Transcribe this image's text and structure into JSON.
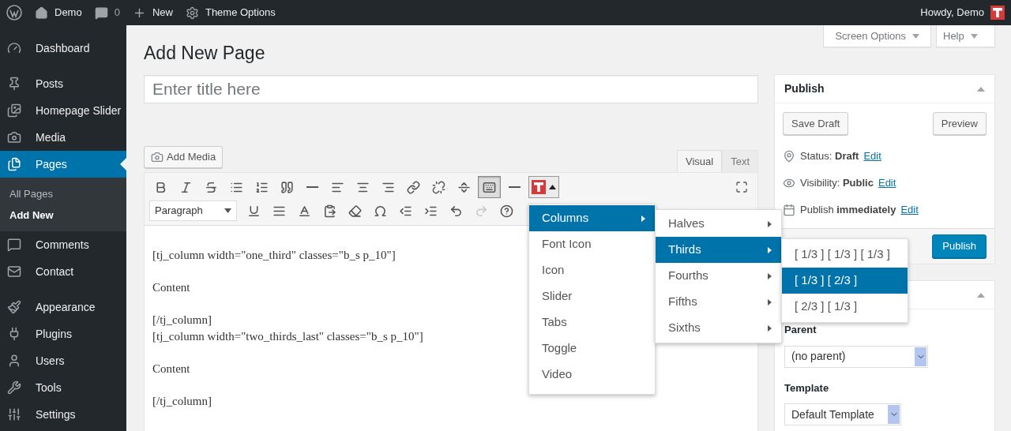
{
  "top_bar": {
    "items": [
      {
        "kind": "home",
        "label": "Demo"
      },
      {
        "kind": "comments",
        "label": "0"
      },
      {
        "kind": "new",
        "label": "New"
      },
      {
        "kind": "gear",
        "label": "Theme Options"
      }
    ],
    "greeting": "Howdy, Demo"
  },
  "sidebar": {
    "groups": [
      [
        {
          "kind": "dashboard",
          "label": "Dashboard",
          "selected": false
        }
      ],
      [
        {
          "kind": "posts",
          "label": "Posts",
          "selected": false
        },
        {
          "kind": "slider",
          "label": "Homepage Slider",
          "selected": false
        },
        {
          "kind": "media",
          "label": "Media",
          "selected": false
        },
        {
          "kind": "pages",
          "label": "Pages",
          "selected": true,
          "children": [
            {
              "label": "All Pages",
              "selected": false
            },
            {
              "label": "Add New",
              "selected": true
            }
          ]
        },
        {
          "kind": "comments",
          "label": "Comments",
          "selected": false
        },
        {
          "kind": "contact",
          "label": "Contact",
          "selected": false
        }
      ],
      [
        {
          "kind": "appearance",
          "label": "Appearance",
          "selected": false
        },
        {
          "kind": "plugins",
          "label": "Plugins",
          "selected": false
        },
        {
          "kind": "users",
          "label": "Users",
          "selected": false
        },
        {
          "kind": "tools",
          "label": "Tools",
          "selected": false
        },
        {
          "kind": "settings",
          "label": "Settings",
          "selected": false
        }
      ]
    ]
  },
  "screen_tabs": [
    "Screen Options",
    "Help"
  ],
  "page_title": "Add New Page",
  "title_field": {
    "placeholder": "Enter title here"
  },
  "add_media": "Add Media",
  "editor_tabs": [
    {
      "label": "Visual",
      "selected": true
    },
    {
      "label": "Text",
      "selected": false
    }
  ],
  "toolbar": {
    "rows": [
      {
        "tools": [
          {
            "kind": "bold",
            "pressed": false,
            "disabled": false
          },
          {
            "kind": "italic",
            "pressed": false,
            "disabled": false
          },
          {
            "kind": "strike",
            "pressed": false,
            "disabled": false
          },
          {
            "kind": "bullets",
            "pressed": false,
            "disabled": false
          },
          {
            "kind": "numbers",
            "pressed": false,
            "disabled": false
          },
          {
            "kind": "quote",
            "pressed": false,
            "disabled": false
          },
          {
            "kind": "rule",
            "pressed": false,
            "disabled": false
          },
          {
            "kind": "align-left",
            "pressed": false,
            "disabled": false
          },
          {
            "kind": "align-center",
            "pressed": false,
            "disabled": false
          },
          {
            "kind": "align-right",
            "pressed": false,
            "disabled": false
          },
          {
            "kind": "link",
            "pressed": false,
            "disabled": false
          },
          {
            "kind": "unlink",
            "pressed": false,
            "disabled": false
          },
          {
            "kind": "more",
            "pressed": false,
            "disabled": false
          },
          {
            "kind": "keyboard",
            "pressed": true,
            "disabled": false
          },
          {
            "kind": "rule",
            "pressed": false,
            "disabled": false
          },
          {
            "kind": "shortcodes",
            "pressed": true,
            "disabled": false
          }
        ]
      },
      {
        "format": "Paragraph",
        "tools": [
          {
            "kind": "underline",
            "pressed": false,
            "disabled": false
          },
          {
            "kind": "justify",
            "pressed": false,
            "disabled": false
          },
          {
            "kind": "text-color",
            "pressed": false,
            "disabled": false
          },
          {
            "kind": "paste",
            "pressed": false,
            "disabled": false
          },
          {
            "kind": "eraser",
            "pressed": false,
            "disabled": false
          },
          {
            "kind": "omega",
            "pressed": false,
            "disabled": false
          },
          {
            "kind": "outdent",
            "pressed": false,
            "disabled": false
          },
          {
            "kind": "indent",
            "pressed": false,
            "disabled": false
          },
          {
            "kind": "undo",
            "pressed": false,
            "disabled": false
          },
          {
            "kind": "redo",
            "pressed": false,
            "disabled": true
          },
          {
            "kind": "help",
            "pressed": false,
            "disabled": false
          }
        ]
      }
    ]
  },
  "content": [
    [
      "[tj_column width=\"one_third\" classes=\"b_s p_10\"]"
    ],
    [
      "Content"
    ],
    [
      "[/tj_column]",
      "[tj_column width=\"two_thirds_last\" classes=\"b_s p_10\"]"
    ],
    [
      "Content"
    ],
    [
      "[/tj_column]"
    ]
  ],
  "shortcode_menu": [
    {
      "label": "Columns",
      "selected": true,
      "has_submenu": true
    },
    {
      "label": "Font Icon",
      "selected": false,
      "has_submenu": false
    },
    {
      "label": "Icon",
      "selected": false,
      "has_submenu": false
    },
    {
      "label": "Slider",
      "selected": false,
      "has_submenu": false
    },
    {
      "label": "Tabs",
      "selected": false,
      "has_submenu": false
    },
    {
      "label": "Toggle",
      "selected": false,
      "has_submenu": false
    },
    {
      "label": "Video",
      "selected": false,
      "has_submenu": false
    }
  ],
  "columns_menu": [
    {
      "label": "Halves",
      "selected": false,
      "has_submenu": true
    },
    {
      "label": "Thirds",
      "selected": true,
      "has_submenu": true
    },
    {
      "label": "Fourths",
      "selected": false,
      "has_submenu": true
    },
    {
      "label": "Fifths",
      "selected": false,
      "has_submenu": true
    },
    {
      "label": "Sixths",
      "selected": false,
      "has_submenu": true
    }
  ],
  "thirds_menu": [
    {
      "label": "[ 1/3 ] [ 1/3 ] [ 1/3 ]",
      "selected": false
    },
    {
      "label": "[ 1/3 ] [ 2/3 ]",
      "selected": true
    },
    {
      "label": "[ 2/3 ] [ 1/3 ]",
      "selected": false
    }
  ],
  "publish_box": {
    "title": "Publish",
    "save_draft": "Save Draft",
    "preview": "Preview",
    "rows": [
      {
        "kind": "status",
        "text": "Status: **Draft**",
        "link": "Edit"
      },
      {
        "kind": "visibility",
        "text": "Visibility: **Public**",
        "link": "Edit"
      },
      {
        "kind": "schedule",
        "text": "Publish **immediately**",
        "link": "Edit"
      }
    ],
    "publish": "Publish"
  },
  "attributes_box": {
    "parent_label": "Parent",
    "parent_value": "(no parent)",
    "template_label": "Template",
    "template_value": "Default Template"
  }
}
